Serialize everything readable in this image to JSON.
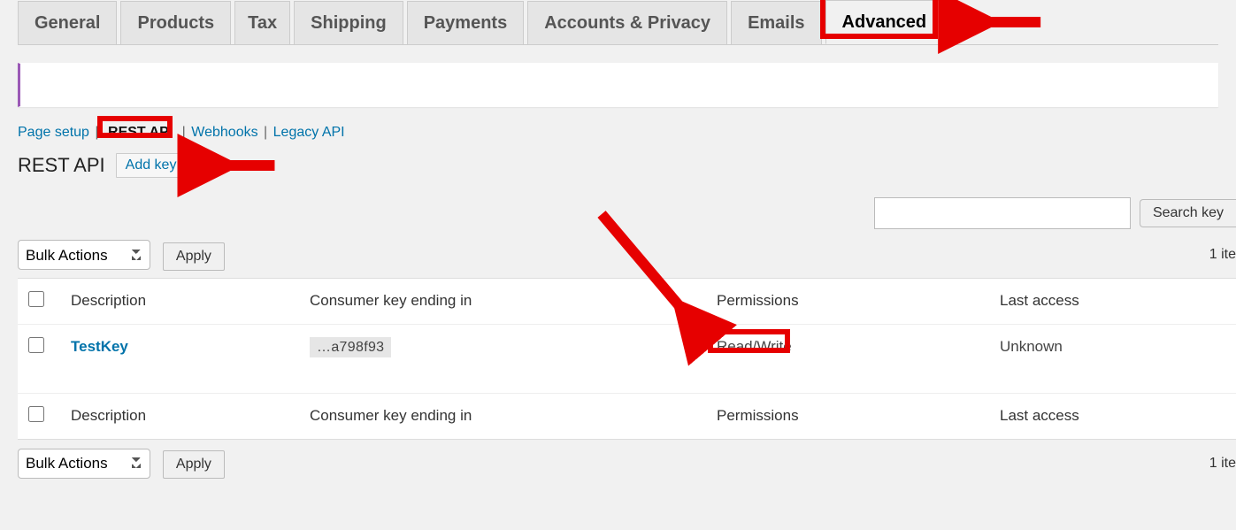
{
  "tabs": {
    "general": "General",
    "products": "Products",
    "tax": "Tax",
    "shipping": "Shipping",
    "payments": "Payments",
    "accounts": "Accounts & Privacy",
    "emails": "Emails",
    "advanced": "Advanced"
  },
  "subtabs": {
    "page_setup": "Page setup",
    "rest_api": "REST API",
    "webhooks": "Webhooks",
    "legacy_api": "Legacy API",
    "sep": "|"
  },
  "heading": {
    "title": "REST API",
    "add_key": "Add key"
  },
  "search": {
    "value": "",
    "button": "Search key"
  },
  "bulk": {
    "label": "Bulk Actions",
    "apply": "Apply"
  },
  "count": "1 ite",
  "table": {
    "cols": {
      "description": "Description",
      "consumer_key": "Consumer key ending in",
      "permissions": "Permissions",
      "last_access": "Last access"
    },
    "rows": [
      {
        "description": "TestKey",
        "consumer_key": "…a798f93",
        "permissions": "Read/Write",
        "last_access": "Unknown"
      }
    ]
  }
}
